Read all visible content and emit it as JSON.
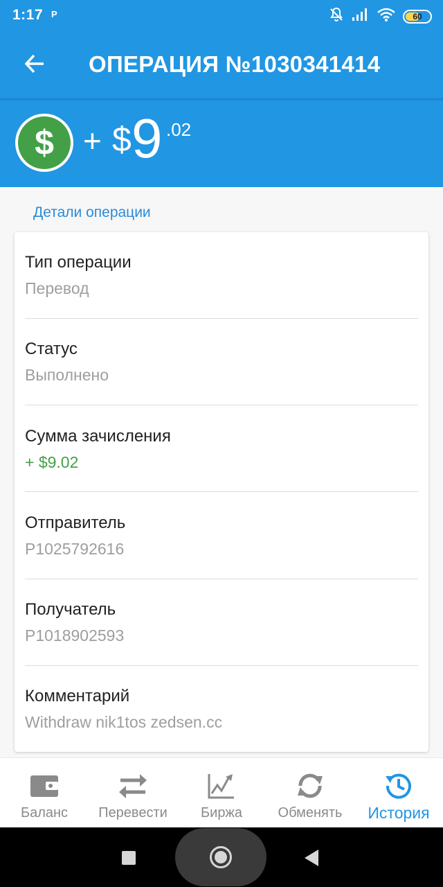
{
  "status_bar": {
    "time": "1:17",
    "app_indicator": "P",
    "battery": "60",
    "battery_fraction": 0.6,
    "icons": [
      "notifications-off-icon",
      "signal-icon",
      "wifi-icon",
      "battery-icon"
    ]
  },
  "header": {
    "title": "ОПЕРАЦИЯ №1030341414",
    "back_icon": "arrow-left-icon"
  },
  "amount": {
    "coin_symbol": "$",
    "sign": "+",
    "currency": "$",
    "integer": "9",
    "cents": ".02"
  },
  "details": {
    "section_title": "Детали операции",
    "rows": [
      {
        "label": "Тип операции",
        "value": "Перевод"
      },
      {
        "label": "Статус",
        "value": "Выполнено"
      },
      {
        "label": "Сумма зачисления",
        "value": "+ $9.02"
      },
      {
        "label": "Отправитель",
        "value": "P1025792616"
      },
      {
        "label": "Получатель",
        "value": "P1018902593"
      },
      {
        "label": "Комментарий",
        "value": "Withdraw nik1tos zedsen.cc"
      }
    ]
  },
  "bottom_nav": {
    "active_index": 4,
    "items": [
      {
        "label": "Баланс",
        "icon": "wallet-icon"
      },
      {
        "label": "Перевести",
        "icon": "transfer-arrows-icon"
      },
      {
        "label": "Биржа",
        "icon": "chart-icon"
      },
      {
        "label": "Обменять",
        "icon": "exchange-icon"
      },
      {
        "label": "История",
        "icon": "history-icon"
      }
    ]
  },
  "colors": {
    "primary": "#2196e3",
    "positive": "#43a047",
    "muted_text": "#9e9e9e",
    "nav_inactive": "#8a8a8a"
  }
}
